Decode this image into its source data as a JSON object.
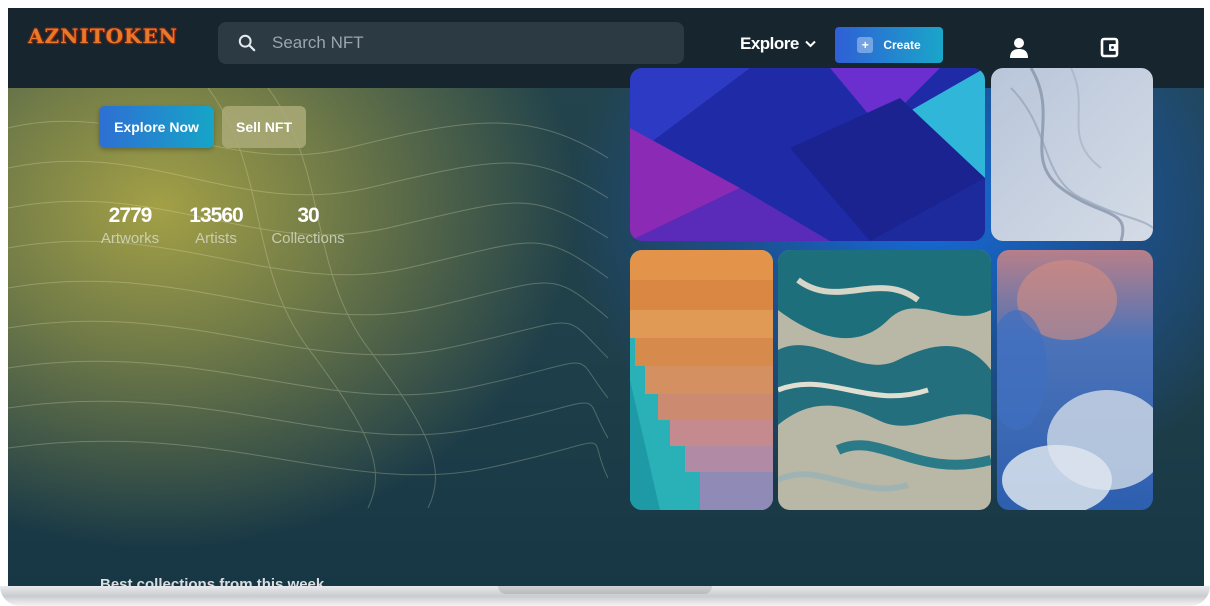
{
  "brand": {
    "logo_text": "AZNITOKEN"
  },
  "search": {
    "placeholder": "Search NFT"
  },
  "nav": {
    "explore_label": "Explore",
    "create_label": "Create",
    "icons": [
      "search-icon",
      "chevron-down-icon",
      "plus-icon",
      "user-icon",
      "wallet-icon"
    ]
  },
  "hero": {
    "explore_button": "Explore Now",
    "sell_button": "Sell NFT",
    "stats": [
      {
        "value": "2779",
        "label": "Artworks"
      },
      {
        "value": "13560",
        "label": "Artists"
      },
      {
        "value": "30",
        "label": "Collections"
      }
    ]
  },
  "section": {
    "title": "Best collections from this week"
  },
  "colors": {
    "navbar": "#16252e",
    "accent_start": "#2e6fd3",
    "accent_end": "#16a5c7",
    "background": "#1f3f4a"
  }
}
